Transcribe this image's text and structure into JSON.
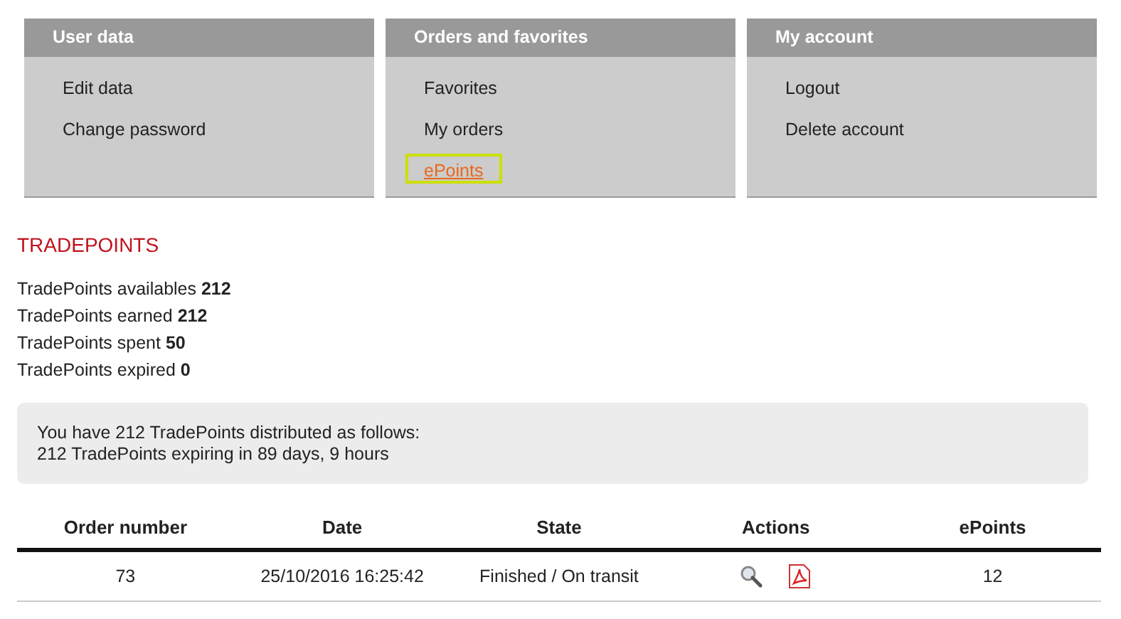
{
  "menu_cards": [
    {
      "title": "User data",
      "links": [
        {
          "label": "Edit data",
          "selected": false
        },
        {
          "label": "Change password",
          "selected": false
        }
      ]
    },
    {
      "title": "Orders and favorites",
      "links": [
        {
          "label": "Favorites",
          "selected": false
        },
        {
          "label": "My orders",
          "selected": false
        },
        {
          "label": "ePoints",
          "selected": true
        }
      ]
    },
    {
      "title": "My account",
      "links": [
        {
          "label": "Logout",
          "selected": false
        },
        {
          "label": "Delete account",
          "selected": false
        }
      ]
    }
  ],
  "section_title": "TRADEPOINTS",
  "stats": [
    {
      "label": "TradePoints availables",
      "value": "212"
    },
    {
      "label": "TradePoints earned",
      "value": "212"
    },
    {
      "label": "TradePoints spent",
      "value": "50"
    },
    {
      "label": "TradePoints expired",
      "value": "0"
    }
  ],
  "notice": [
    "You have 212 TradePoints distributed as follows:",
    "212 TradePoints expiring in 89 days, 9 hours"
  ],
  "table": {
    "columns": [
      "Order number",
      "Date",
      "State",
      "Actions",
      "ePoints"
    ],
    "rows": [
      {
        "cells": [
          "73",
          "25/10/2016 16:25:42",
          "Finished / On transit",
          null,
          "12"
        ],
        "actions": [
          {
            "kind": "view"
          },
          {
            "kind": "pdf"
          }
        ]
      }
    ]
  }
}
